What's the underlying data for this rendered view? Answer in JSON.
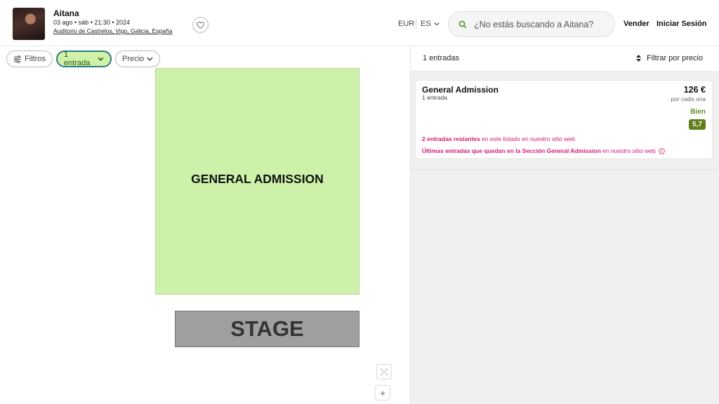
{
  "event": {
    "title": "Aitana",
    "date_line": "03 ago • sáb • 21:30 • 2024",
    "venue": "Auditorio de Castrelos, Vigo, Galicia, España",
    "thumbnail_icon": "artist-photo",
    "favorite_icon": "heart-icon"
  },
  "header": {
    "currency": "EUR",
    "language": "ES",
    "search_placeholder": "¿No estás buscando a Aitana?",
    "sell_label": "Vender",
    "login_label": "Iniciar Sesión"
  },
  "filters": {
    "filters_label": "Filtros",
    "quantity_label": "1 entrada",
    "price_label": "Precio"
  },
  "map": {
    "section_label": "GENERAL ADMISSION",
    "stage_label": "STAGE",
    "section_color": "#cdf1aa",
    "stage_color": "#9f9f9f",
    "zoom_in_label": "+"
  },
  "listings_panel": {
    "count_label": "1 entradas",
    "sort_label": "Filtrar por precio",
    "listings": [
      {
        "section": "General Admission",
        "quantity": "1 entrada",
        "price": "126 €",
        "price_note": "por cada una",
        "rating_label": "Bien",
        "rating_score": "5,7",
        "note1_bold": "2 entradas restantes",
        "note1_rest": " en este listado en nuestro sitio web",
        "note2_bold": "Últimas entradas que quedan en la Sección General Admission",
        "note2_rest": " en nuestro sitio web"
      }
    ]
  },
  "colors": {
    "accent_green": "#cdf1aa",
    "quantity_border": "#2a7a82",
    "rating_green": "#5f7d18",
    "alert_pink": "#d6186b"
  }
}
